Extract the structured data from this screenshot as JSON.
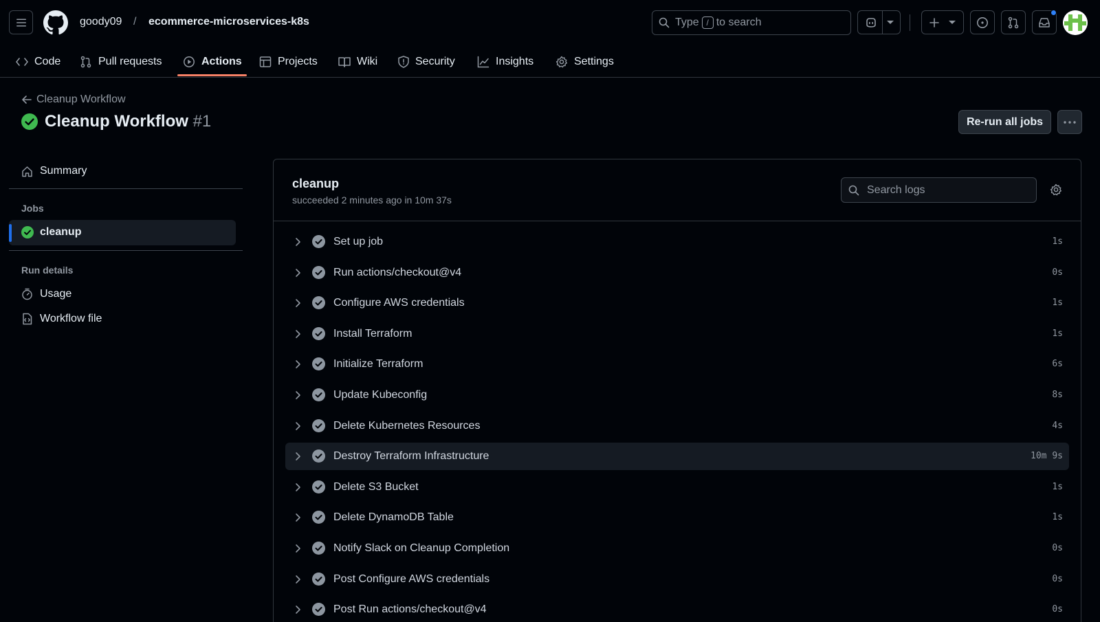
{
  "header": {
    "owner": "goody09",
    "separator": "/",
    "repo": "ecommerce-microservices-k8s",
    "search": {
      "prefix": "Type",
      "key": "/",
      "suffix": "to search"
    }
  },
  "nav": {
    "tabs": [
      {
        "label": "Code"
      },
      {
        "label": "Pull requests"
      },
      {
        "label": "Actions"
      },
      {
        "label": "Projects"
      },
      {
        "label": "Wiki"
      },
      {
        "label": "Security"
      },
      {
        "label": "Insights"
      },
      {
        "label": "Settings"
      }
    ],
    "active": "Actions"
  },
  "run": {
    "back_label": "Cleanup Workflow",
    "title": "Cleanup Workflow",
    "number": "#1",
    "rerun_label": "Re-run all jobs"
  },
  "sidebar": {
    "summary_label": "Summary",
    "jobs_heading": "Jobs",
    "job_label": "cleanup",
    "run_details_heading": "Run details",
    "usage_label": "Usage",
    "workflow_file_label": "Workflow file"
  },
  "job": {
    "name": "cleanup",
    "meta": "succeeded 2 minutes ago in 10m 37s",
    "search_placeholder": "Search logs",
    "steps": [
      {
        "name": "Set up job",
        "duration": "1s"
      },
      {
        "name": "Run actions/checkout@v4",
        "duration": "0s"
      },
      {
        "name": "Configure AWS credentials",
        "duration": "1s"
      },
      {
        "name": "Install Terraform",
        "duration": "1s"
      },
      {
        "name": "Initialize Terraform",
        "duration": "6s"
      },
      {
        "name": "Update Kubeconfig",
        "duration": "8s"
      },
      {
        "name": "Delete Kubernetes Resources",
        "duration": "4s"
      },
      {
        "name": "Destroy Terraform Infrastructure",
        "duration": "10m 9s"
      },
      {
        "name": "Delete S3 Bucket",
        "duration": "1s"
      },
      {
        "name": "Delete DynamoDB Table",
        "duration": "1s"
      },
      {
        "name": "Notify Slack on Cleanup Completion",
        "duration": "0s"
      },
      {
        "name": "Post Configure AWS credentials",
        "duration": "0s"
      },
      {
        "name": "Post Run actions/checkout@v4",
        "duration": "0s"
      }
    ]
  },
  "colors": {
    "background": "#010409",
    "success": "#3fb950",
    "accent_underline": "#f78166",
    "active_bar": "#1f6feb",
    "notification_dot": "#2f81f7"
  }
}
